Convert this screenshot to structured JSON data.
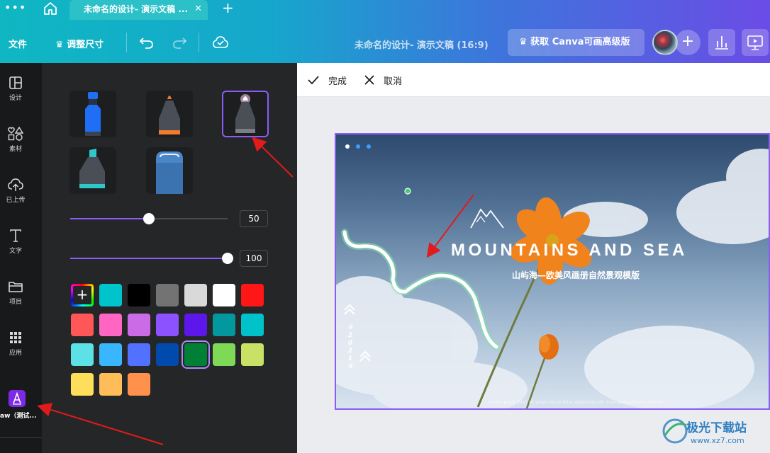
{
  "browser": {
    "tab_title": "未命名的设计- 演示文稿 ...",
    "tab_close": "✕",
    "new_tab": "+",
    "menu_dots": "•••"
  },
  "toolbar": {
    "file_label": "文件",
    "resize_label": "♛ 调整尺寸",
    "doc_title": "未命名的设计- 演示文稿 (16:9)",
    "upgrade_label": "♛ 获取 Canva可画高级版",
    "add_member": "+"
  },
  "sidebar": {
    "items": [
      {
        "label": "设计",
        "icon": "layout-icon"
      },
      {
        "label": "素材",
        "icon": "shapes-icon"
      },
      {
        "label": "已上传",
        "icon": "cloud-upload-icon"
      },
      {
        "label": "文字",
        "icon": "text-icon"
      },
      {
        "label": "项目",
        "icon": "folder-icon"
      },
      {
        "label": "应用",
        "icon": "apps-grid-icon"
      }
    ],
    "draw_app_label": "aw（测试..."
  },
  "draw_panel": {
    "pens": [
      {
        "name": "marker",
        "tip_color": "#1e6ff5",
        "selected": false
      },
      {
        "name": "pen",
        "tip_color": "#f07b2a",
        "selected": false
      },
      {
        "name": "glow-pen",
        "tip_color": "#f3c4ef",
        "selected": true
      },
      {
        "name": "highlighter",
        "tip_color": "#2ec8c8",
        "selected": false
      },
      {
        "name": "eraser",
        "tip_color": "#4a86c7",
        "selected": false
      }
    ],
    "size_value": "50",
    "size_percent": 50,
    "transparency_value": "100",
    "transparency_percent": 100,
    "add_color_symbol": "+",
    "swatches": [
      "#00c4cc",
      "#000000",
      "#737373",
      "#d9d9d9",
      "#ffffff",
      "#ff1616",
      "#ff5757",
      "#ff66c4",
      "#cb6ce6",
      "#8c52ff",
      "#5e17eb",
      "#03989e",
      "#00c2cb",
      "#5ce1e6",
      "#38b6ff",
      "#5271ff",
      "#004aad",
      "#008037",
      "#7ed957",
      "#c9e265",
      "#ffde59",
      "#ffbd59",
      "#ff914d"
    ],
    "selected_swatch": "#008037",
    "collapse_symbol": "‹"
  },
  "edit_bar": {
    "done_label": "完成",
    "cancel_label": "取消"
  },
  "slide": {
    "title": "MOUNTAINS AND SEA",
    "subtitle": "山屿海—欧美风画册自然景观模版",
    "year": "#2021#",
    "footer": "Lorem ipsum dolor sit amet consectetur adipiscing elit massased pulvinar ultricies."
  },
  "watermark": {
    "name": "极光下载站",
    "url": "www.xz7.com"
  }
}
